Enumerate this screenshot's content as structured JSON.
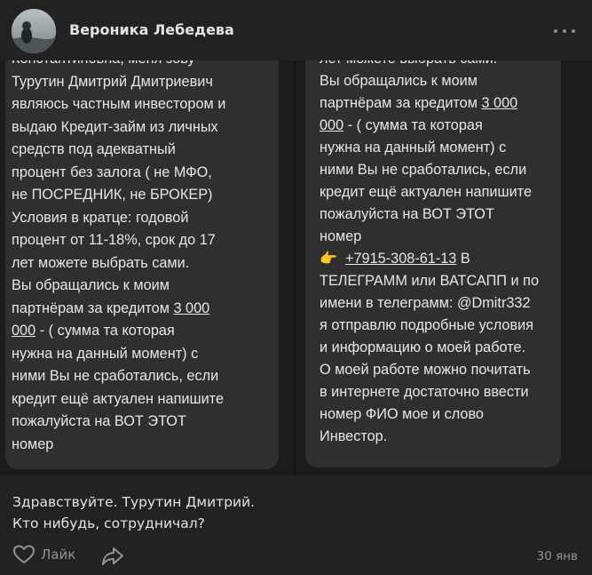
{
  "post": {
    "author_name": "Вероника Лебедева",
    "caption_lines": [
      "Здравствуйте. Турутин Дмитрий.",
      "Кто нибудь, сотрудничал?"
    ],
    "date": "30 янв"
  },
  "actions": {
    "like_label": "Лайк"
  },
  "icons": {
    "more": "more-horizontal-icon",
    "like": "heart-outline-icon",
    "share": "share-arrow-icon",
    "emoji": "pointing-hand-emoji"
  },
  "colors": {
    "background": "#222222",
    "bubble": "#2f2f2f",
    "muted": "#909499",
    "text": "#e1e3e6"
  },
  "screenshot_left": {
    "lines": [
      "Константиновна, меня зову",
      "Турутин Дмитрий Дмитриевич",
      "являюсь частным инвестором и",
      "выдаю Кредит-займ из личных",
      "средств под адекватный",
      "процент без залога ( не МФО,",
      "не ПОСРЕДНИК,  не БРОКЕР)",
      "Условия в кратце: годовой",
      "процент  от 11-18%, срок до 17",
      "лет можете выбрать сами.",
      "Вы обращались к моим",
      "партнёрам за кредитом ",
      "3 000",
      "000",
      " - ( сумма  та которая",
      "нужна на данный момент) с",
      "ними Вы не сработались, если",
      "кредит ещё актуален напишите",
      "пожалуйста на ВОТ ЭТОТ",
      "номер"
    ]
  },
  "screenshot_right": {
    "lines": [
      "лет можете выбрать сами.",
      "Вы обращались к моим",
      "партнёрам за кредитом ",
      "3 000",
      "000",
      " - ( сумма  та которая",
      "нужна на данный момент) с",
      "ними Вы не сработались, если",
      "кредит ещё актуален напишите",
      "пожалуйста на ВОТ ЭТОТ",
      "номер",
      "👉",
      "+7915-308-61-13",
      " В",
      "ТЕЛЕГРАММ или ВАТСАПП  и по",
      "имени в телеграмм: @Dmitr332",
      "я отправлю подробные условия",
      "и информацию о моей работе.",
      "О моей работе можно почитать",
      "в интернете достаточно ввести",
      "номер ФИО мое и слово",
      "Инвестор."
    ]
  }
}
